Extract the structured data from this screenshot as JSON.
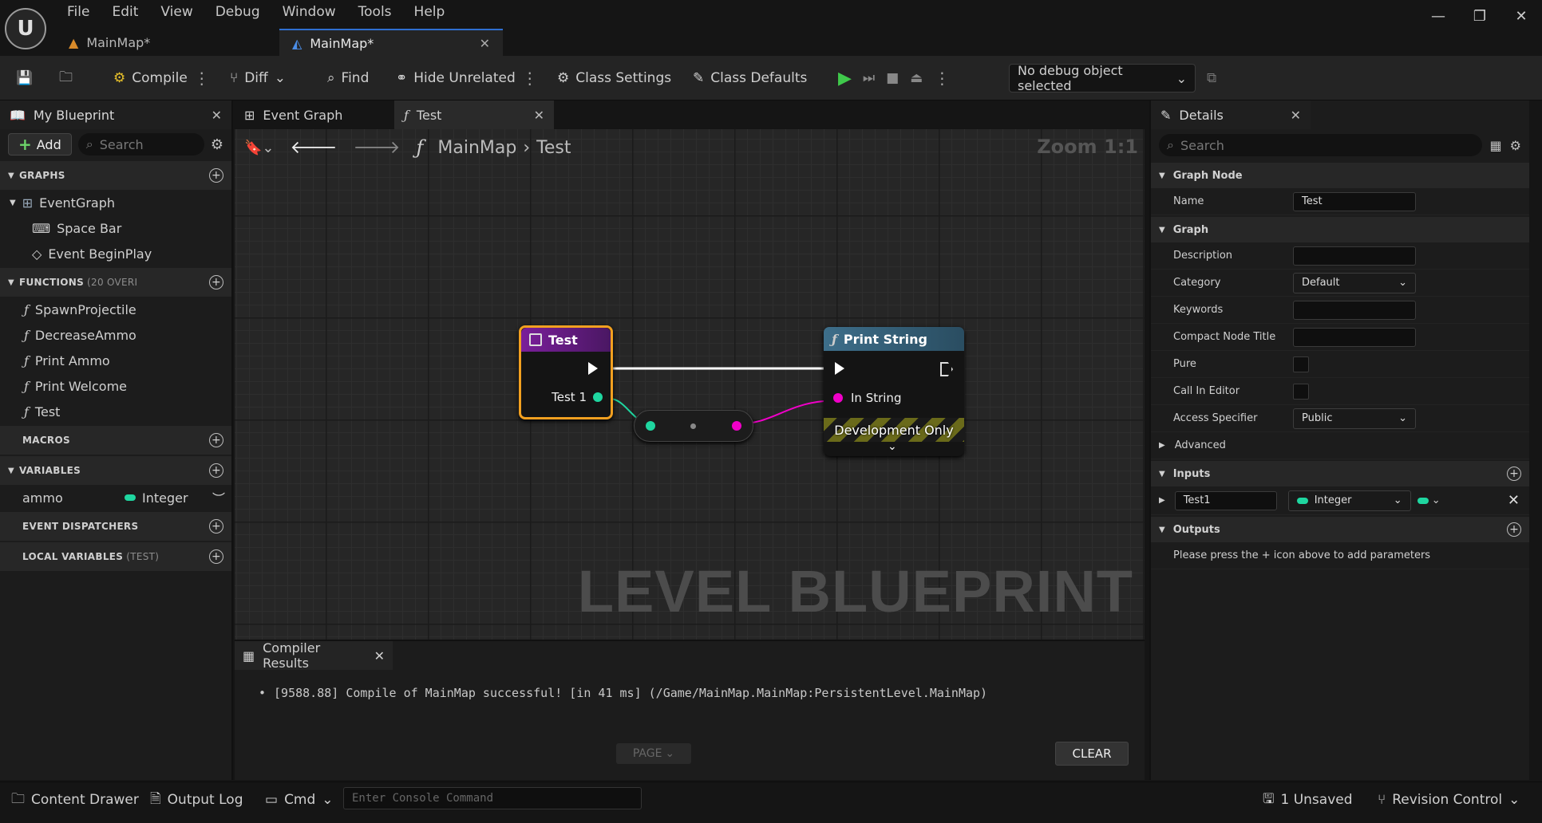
{
  "menu": [
    "File",
    "Edit",
    "View",
    "Debug",
    "Window",
    "Tools",
    "Help"
  ],
  "doc_tabs": [
    {
      "label": "MainMap*",
      "active": false
    },
    {
      "label": "MainMap*",
      "active": true
    }
  ],
  "toolbar": {
    "compile": "Compile",
    "diff": "Diff",
    "find": "Find",
    "hide_unrelated": "Hide Unrelated",
    "class_settings": "Class Settings",
    "class_defaults": "Class Defaults",
    "debug_object": "No debug object selected"
  },
  "my_blueprint": {
    "title": "My Blueprint",
    "add": "Add",
    "search_placeholder": "Search",
    "graphs_header": "GRAPHS",
    "event_graph": "EventGraph",
    "events": [
      "Space Bar",
      "Event BeginPlay"
    ],
    "functions_header": "FUNCTIONS",
    "functions_sub": "(20 OVERI",
    "functions": [
      "SpawnProjectile",
      "DecreaseAmmo",
      "Print Ammo",
      "Print Welcome",
      "Test"
    ],
    "macros_header": "MACROS",
    "variables_header": "VARIABLES",
    "variable": {
      "name": "ammo",
      "type": "Integer"
    },
    "dispatchers_header": "EVENT DISPATCHERS",
    "locals_header": "LOCAL VARIABLES",
    "locals_sub": "(TEST)"
  },
  "graph_tabs": [
    {
      "label": "Event Graph",
      "active": false
    },
    {
      "label": "Test",
      "active": true
    }
  ],
  "graph": {
    "breadcrumb_root": "MainMap",
    "breadcrumb_leaf": "Test",
    "zoom": "Zoom 1:1",
    "watermark": "LEVEL BLUEPRINT",
    "entry_node": {
      "title": "Test",
      "pin": "Test 1"
    },
    "print_node": {
      "title": "Print String",
      "pin": "In String",
      "footer": "Development Only"
    }
  },
  "compiler": {
    "tab": "Compiler Results",
    "message": "[9588.88] Compile of MainMap successful! [in 41 ms] (/Game/MainMap.MainMap:PersistentLevel.MainMap)",
    "page": "PAGE",
    "clear": "CLEAR"
  },
  "details": {
    "title": "Details",
    "search_placeholder": "Search",
    "graph_node_header": "Graph Node",
    "name_label": "Name",
    "name_value": "Test",
    "graph_header": "Graph",
    "description_label": "Description",
    "category_label": "Category",
    "category_value": "Default",
    "keywords_label": "Keywords",
    "compact_label": "Compact Node Title",
    "pure_label": "Pure",
    "call_in_editor_label": "Call In Editor",
    "access_label": "Access Specifier",
    "access_value": "Public",
    "advanced_header": "Advanced",
    "inputs_header": "Inputs",
    "input_name": "Test1",
    "input_type": "Integer",
    "outputs_header": "Outputs",
    "outputs_hint": "Please press the + icon above to add parameters"
  },
  "status": {
    "content_drawer": "Content Drawer",
    "output_log": "Output Log",
    "cmd": "Cmd",
    "cmd_placeholder": "Enter Console Command",
    "unsaved": "1 Unsaved",
    "revision": "Revision Control"
  },
  "colors": {
    "accent": "#2f6fd1",
    "play": "#3fc94b",
    "integer_pin": "#1fd6a0",
    "string_pin": "#f000c8",
    "entry_header": "#7a1f9a",
    "print_header": "#3d6e8a",
    "selected": "#f2a020"
  }
}
